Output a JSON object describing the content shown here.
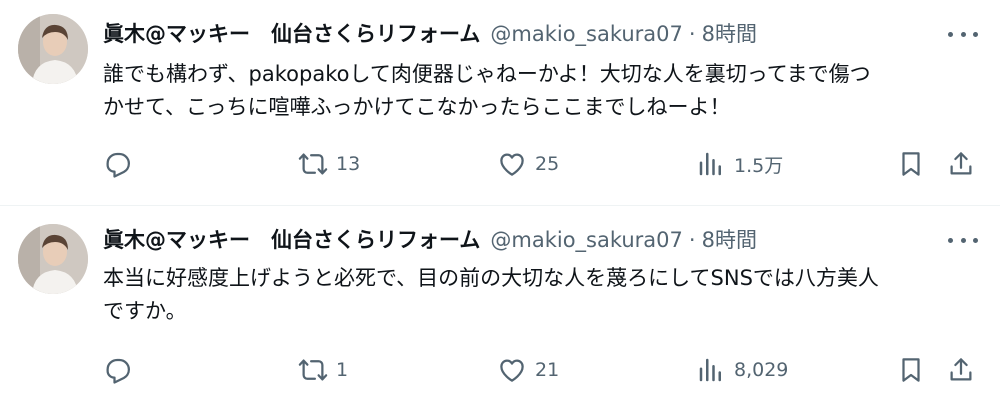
{
  "tweets": [
    {
      "author": "眞木@マッキー　仙台さくらリフォーム",
      "handle": "@makio_sakura07",
      "separator": "·",
      "time": "8時間",
      "text": "誰でも構わず、pakopakoして肉便器じゃねーかよ！大切な人を裏切ってまで傷つ\nかせて、こっちに喧嘩ふっかけてこなかったらここまでしねーよ！",
      "retweets": "13",
      "likes": "25",
      "views": "1.5万",
      "icons": [
        "reply-icon",
        "retweet-icon",
        "like-icon",
        "views-icon",
        "bookmark-icon",
        "share-icon",
        "more-icon"
      ]
    },
    {
      "author": "眞木@マッキー　仙台さくらリフォーム",
      "handle": "@makio_sakura07",
      "separator": "·",
      "time": "8時間",
      "text": "本当に好感度上げようと必死で、目の前の大切な人を蔑ろにしてSNSでは八方美人\nですか。",
      "retweets": "1",
      "likes": "21",
      "views": "8,029",
      "icons": [
        "reply-icon",
        "retweet-icon",
        "like-icon",
        "views-icon",
        "bookmark-icon",
        "share-icon",
        "more-icon"
      ]
    }
  ],
  "colors": {
    "text": "#0f1419",
    "secondary": "#536471",
    "divider": "#eff3f4"
  }
}
